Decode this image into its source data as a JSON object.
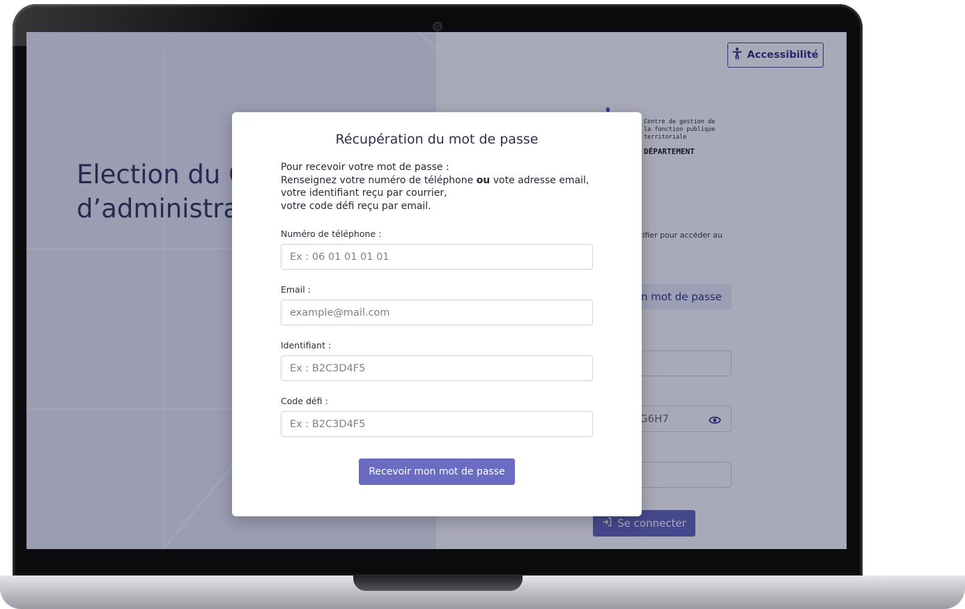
{
  "background_page": {
    "hero_title": "Election du C\nd’administra",
    "accessibility_label": "Accessibilité",
    "organization_lines": "Centre de gestion de\nla fonction publique\nterritoriale",
    "organization_strong": "DÉPARTEMENT",
    "intro_partial": "tifier pour accéder au",
    "tab_partial": "n mot de passe",
    "password_partial": "G6H7",
    "connect_label": "Se connecter"
  },
  "modal": {
    "title": "Récupération du mot de passe",
    "instructions": {
      "line1": "Pour recevoir votre mot de passe :",
      "line2_before": "Renseignez votre numéro de téléphone ",
      "line2_or": "ou",
      "line2_after": " vote adresse email,",
      "line3": "votre identifiant reçu par courrier,",
      "line4": "votre code défi reçu par email."
    },
    "fields": [
      {
        "label": "Numéro de téléphone :",
        "placeholder": "Ex : 06 01 01 01 01"
      },
      {
        "label": "Email :",
        "placeholder": "example@mail.com"
      },
      {
        "label": "Identifiant :",
        "placeholder": "Ex : B2C3D4F5"
      },
      {
        "label": "Code défi :",
        "placeholder": "Ex : B2C3D4F5"
      }
    ],
    "submit_label": "Recevoir mon mot de passe"
  },
  "colors": {
    "brand": "#2b2c7a",
    "primary_button": "#6a6cc4",
    "overlay": "#1e2046"
  }
}
